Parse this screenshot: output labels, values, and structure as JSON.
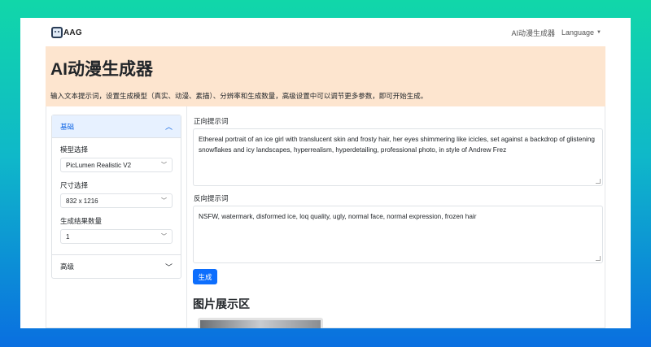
{
  "brand": {
    "name": "AAG"
  },
  "nav": {
    "app_link": "AI动漫生成器",
    "language": "Language"
  },
  "hero": {
    "title": "AI动漫生成器",
    "description": "输入文本提示词，设置生成模型（真实、动漫、素描）、分辨率和生成数量，高级设置中可以调节更多参数，即可开始生成。"
  },
  "sidebar": {
    "basic_label": "基础",
    "model_label": "模型选择",
    "model_value": "PicLumen Realistic V2",
    "size_label": "尺寸选择",
    "size_value": "832 x 1216",
    "count_label": "生成结果数量",
    "count_value": "1",
    "advanced_label": "高级"
  },
  "main": {
    "positive_label": "正向提示词",
    "positive_prompt": "Ethereal portrait of an ice girl with translucent skin and frosty hair, her eyes shimmering like icicles, set against a backdrop of glistening snowflakes and icy landscapes, hyperrealism, hyperdetailing, professional photo, in style of Andrew Frez",
    "negative_label": "反向提示词",
    "negative_prompt": "NSFW, watermark, disformed ice, loq quality, ugly, normal face, normal expression, frozen hair",
    "generate_label": "生成",
    "gallery_title": "图片展示区"
  },
  "icons": {
    "logo": "robot-face-icon",
    "chevron": "chevron-icon",
    "caret": "caret-down-icon"
  }
}
